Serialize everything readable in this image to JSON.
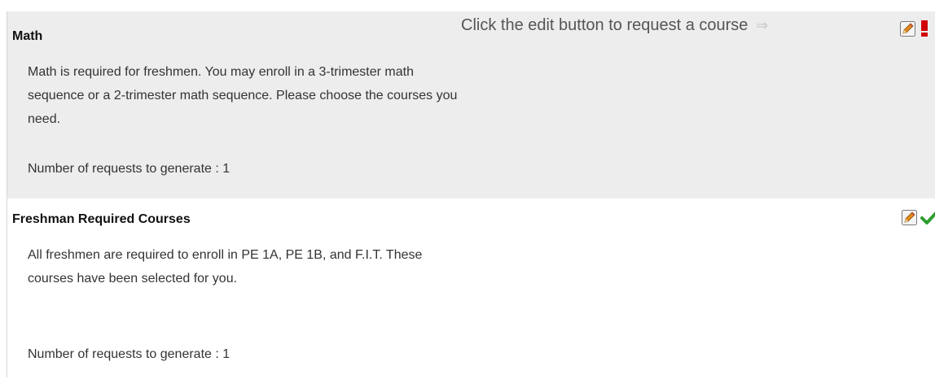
{
  "hint": {
    "text": "Click the edit button to request a course",
    "arrow": "⇒"
  },
  "sections": [
    {
      "title": "Math",
      "description": "Math is required for freshmen. You may enroll in a 3-trimester math sequence or a 2-trimester math sequence. Please choose the courses you need.",
      "requests_label": "Number of requests to generate : 1",
      "status": "incomplete",
      "status_icon": "exclamation-icon",
      "status_color": "#d00000"
    },
    {
      "title": "Freshman Required Courses",
      "description": "All freshmen are required to enroll in PE 1A, PE 1B, and F.I.T. These courses have been selected for you.",
      "requests_label": "Number of requests to generate : 1",
      "status": "complete",
      "status_icon": "checkmark-icon",
      "status_color": "#2e9e2e"
    }
  ],
  "colors": {
    "section_alt_bg": "#ededed",
    "pencil": "#e08a1e"
  }
}
